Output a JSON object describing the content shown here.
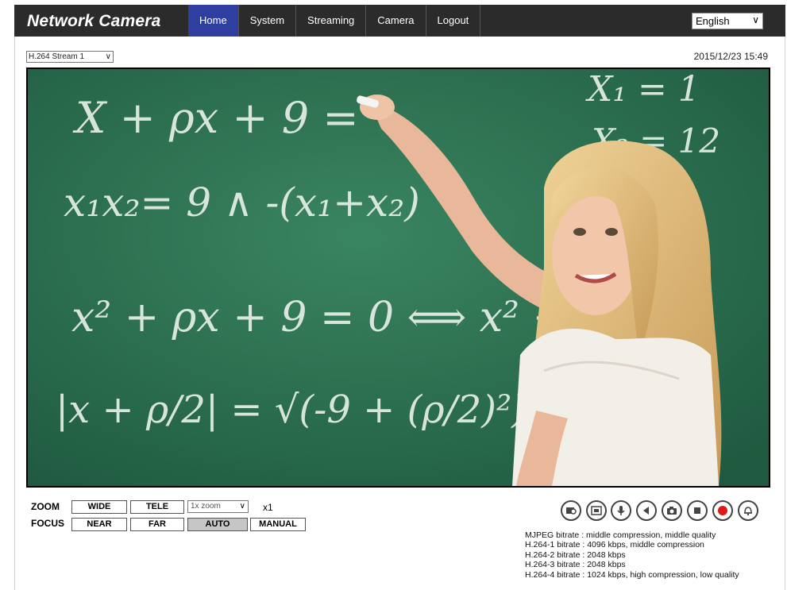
{
  "header": {
    "brand": "Network Camera",
    "nav": [
      "Home",
      "System",
      "Streaming",
      "Camera",
      "Logout"
    ],
    "language": "English"
  },
  "viewer": {
    "stream_select": "H.264 Stream 1",
    "datetime": "2015/12/23 15:49",
    "board_text": {
      "line1": "X  + ρx + 9 =",
      "line2": "x₁x₂= 9  ∧  -(x₁+x₂)",
      "line3": "x² + ρx + 9 = 0  ⟺  x² + ρx",
      "line4": "|x + ρ/2| = √(-9 + (ρ/2)²)",
      "right1": "X₁ = 1",
      "right2": "X₂ = 12"
    }
  },
  "controls": {
    "zoom_label": "ZOOM",
    "focus_label": "FOCUS",
    "wide": "WIDE",
    "tele": "TELE",
    "zoom_select": "1x zoom",
    "zoom_value": "x1",
    "near": "NEAR",
    "far": "FAR",
    "auto": "AUTO",
    "manual": "MANUAL",
    "icons": [
      "snapshot-gallery-icon",
      "fullscreen-icon",
      "microphone-icon",
      "speaker-icon",
      "camera-icon",
      "stop-icon",
      "record-icon",
      "alarm-bell-icon"
    ]
  },
  "bitrate": [
    "MJPEG bitrate : middle compression, middle quality",
    "H.264-1 bitrate : 4096 kbps, middle compression",
    "H.264-2 bitrate : 2048 kbps",
    "H.264-3 bitrate : 2048 kbps",
    "H.264-4 bitrate : 1024 kbps, high compression, low quality"
  ],
  "colors": {
    "topbar": "#2b2b2b",
    "nav_active": "#2f3fa0",
    "chalkboard": "#2c6b4e",
    "record_red": "#e01818"
  }
}
